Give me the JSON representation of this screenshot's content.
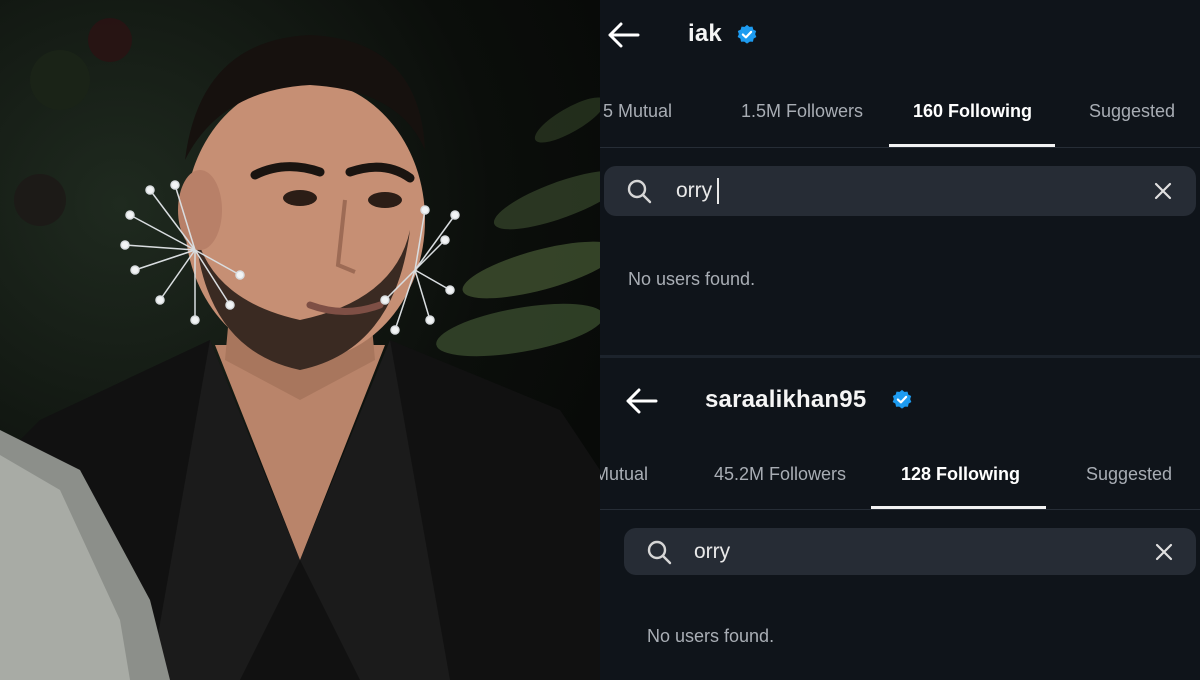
{
  "top_profile": {
    "username": "iak",
    "tabs": {
      "mutual": "5 Mutual",
      "followers": "1.5M Followers",
      "following": "160 Following",
      "suggested": "Suggested"
    },
    "active_tab": "following",
    "search": {
      "query": "orry"
    },
    "empty_message": "No users found."
  },
  "bottom_profile": {
    "username": "saraalikhan95",
    "tabs": {
      "mutual": "Mutual",
      "followers": "45.2M Followers",
      "following": "128 Following",
      "suggested": "Suggested"
    },
    "active_tab": "following",
    "search": {
      "query": "orry"
    },
    "empty_message": "No users found."
  },
  "colors": {
    "background": "#0f141a",
    "verified_badge": "#1d9bf0",
    "search_field": "#262c35",
    "active_tab_underline": "#f2f2f2"
  },
  "icons": [
    "back-arrow-icon",
    "verified-badge-icon",
    "search-icon",
    "close-icon"
  ]
}
